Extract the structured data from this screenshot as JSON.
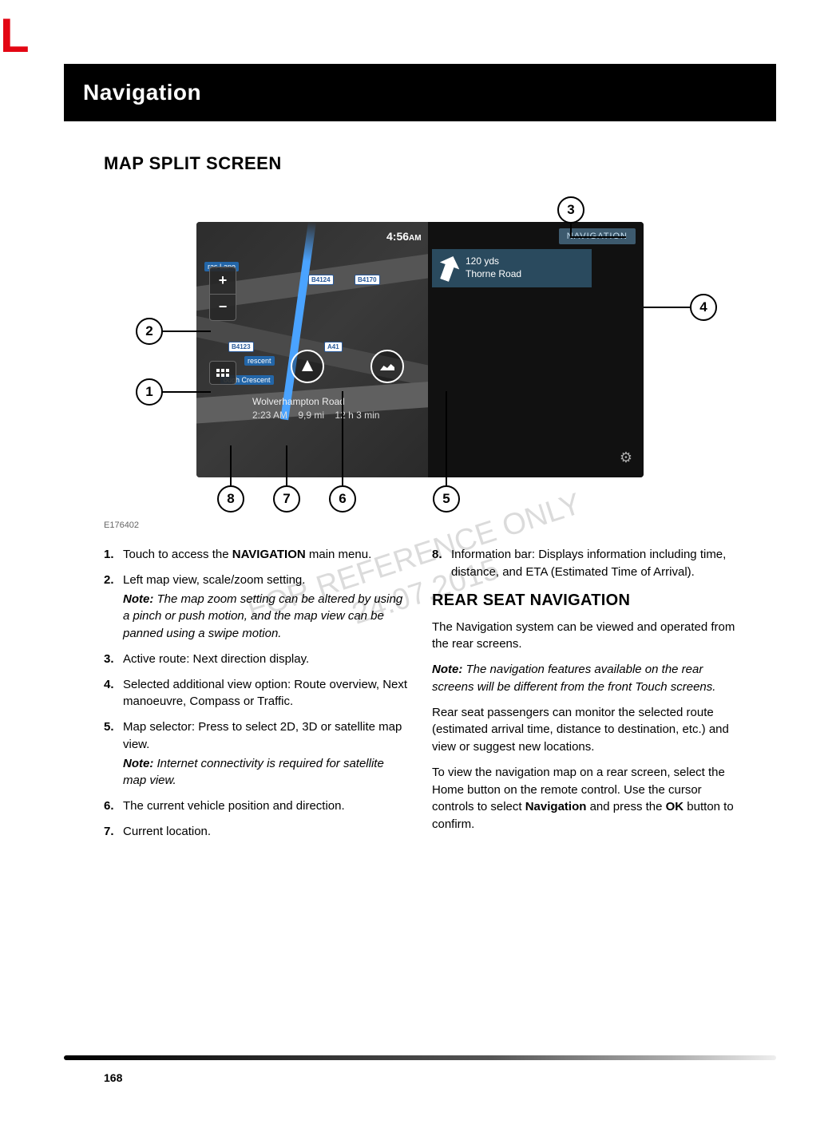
{
  "brand_letter": "L",
  "header_title": "Navigation",
  "section_title": "MAP SPLIT SCREEN",
  "figure_code": "E176402",
  "page_number": "168",
  "watermark_line1": "FOR REFERENCE ONLY",
  "watermark_line2": "24.07.2015",
  "diagram": {
    "clock": "4:56",
    "clock_period": "AM",
    "nav_button": "NAVIGATION",
    "direction_distance": "120 yds",
    "direction_road": "Thorne Road",
    "current_location": "Wolverhampton Road",
    "eta": "2:23 AM",
    "distance": "9,9 mi",
    "duration": "12 h 3 min",
    "zoom_plus": "+",
    "zoom_minus": "−",
    "back_glyph": "↶",
    "settings_glyph": "⚙",
    "shield1": "B4124",
    "shield2": "B4170",
    "shield3": "B4123",
    "shield4": "A41",
    "street1": "ras Lane",
    "street2": "rescent",
    "street3": "ough Crescent",
    "callouts": {
      "c1": "1",
      "c2": "2",
      "c3": "3",
      "c4": "4",
      "c5": "5",
      "c6": "6",
      "c7": "7",
      "c8": "8"
    }
  },
  "left_list": [
    {
      "num": "1.",
      "text_pre": "Touch to access the ",
      "bold": "NAVIGATION",
      "text_post": " main menu."
    },
    {
      "num": "2.",
      "text": "Left map view, scale/zoom setting.",
      "note": "The map zoom setting can be altered by using a pinch or push motion, and the map view can be panned using a swipe motion."
    },
    {
      "num": "3.",
      "text": "Active route: Next direction display."
    },
    {
      "num": "4.",
      "text": "Selected additional view option: Route overview, Next manoeuvre, Compass or Traffic."
    },
    {
      "num": "5.",
      "text": "Map selector: Press to select 2D, 3D or satellite map view.",
      "note": "Internet connectivity is required for satellite map view."
    },
    {
      "num": "6.",
      "text": "The current vehicle position and direction."
    },
    {
      "num": "7.",
      "text": "Current location."
    }
  ],
  "right_list_item": {
    "num": "8.",
    "text": "Information bar: Displays information including time, distance, and ETA (Estimated Time of Arrival)."
  },
  "right_section_title": "REAR SEAT NAVIGATION",
  "right_paras": {
    "p1": "The Navigation system can be viewed and operated from the rear screens.",
    "note": "The navigation features available on the rear screens will be different from the front Touch screens.",
    "p2": "Rear seat passengers can monitor the selected route (estimated arrival time, distance to destination, etc.) and view or suggest new locations.",
    "p3_pre": "To view the navigation map on a rear screen, select the Home button on the remote control. Use the cursor controls to select ",
    "p3_bold1": "Navigation",
    "p3_mid": " and press the ",
    "p3_bold2": "OK",
    "p3_post": " button to confirm."
  },
  "note_label": "Note:"
}
